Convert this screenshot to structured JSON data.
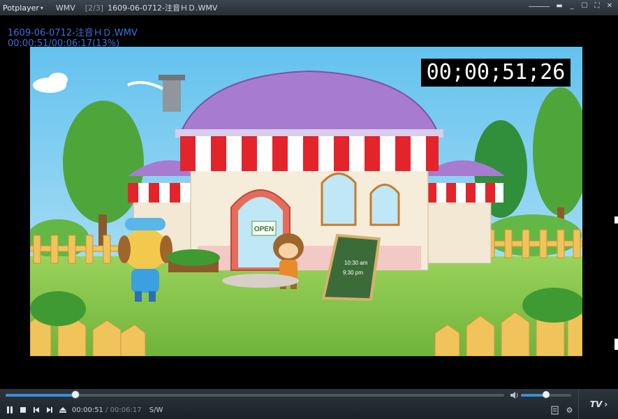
{
  "window": {
    "app_name": "Potplayer",
    "format": "WMV",
    "playlist_pos": "[2/3]",
    "file_title": "1609-06-0712-注音ＨＤ.WMV"
  },
  "osd": {
    "filename": "1609-06-0712-注音ＨＤ.WMV",
    "progress": "00:00:51/00:06:17(13%)"
  },
  "video": {
    "timecode": "00;00;51;26",
    "sign_text": "OPEN",
    "board_line1": "10:30 am",
    "board_line2": "9:30 pm"
  },
  "controls": {
    "current_time": "00:00:51",
    "duration": "00:06:17",
    "separator": "/",
    "mode": "S/W",
    "tv_label": "TV",
    "seek_fraction": 0.14,
    "volume_fraction": 0.5
  },
  "icons": {
    "play_pause": "pause-icon",
    "stop": "stop-icon",
    "prev": "previous-icon",
    "next": "next-icon",
    "eject": "eject-icon",
    "playlist": "playlist-icon",
    "settings": "gear-icon",
    "volume": "speaker-icon"
  },
  "colors": {
    "osd_text": "#3d6fe0",
    "seek_fill": "#3a8fd8"
  }
}
